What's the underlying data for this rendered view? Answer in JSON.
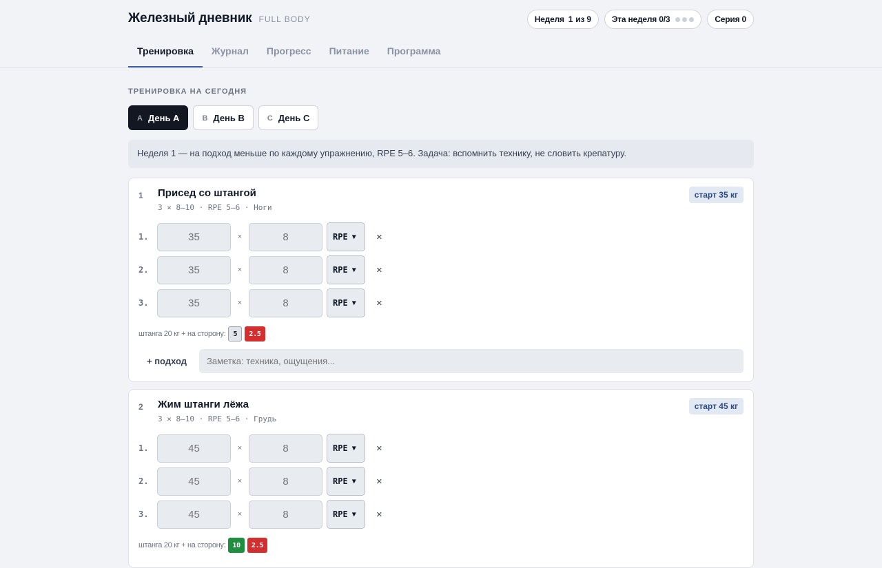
{
  "header": {
    "title": "Железный дневник",
    "subtitle": "FULL BODY",
    "week_label": "Неделя",
    "week_num": "1",
    "week_of": "из 9",
    "this_week": "Эта неделя 0/3",
    "streak": "Серия 0"
  },
  "tabs": [
    "Тренировка",
    "Журнал",
    "Прогресс",
    "Питание",
    "Программа"
  ],
  "section_label": "ТРЕНИРОВКА НА СЕГОДНЯ",
  "days": [
    {
      "letter": "A",
      "label": "День A"
    },
    {
      "letter": "B",
      "label": "День B"
    },
    {
      "letter": "C",
      "label": "День C"
    }
  ],
  "notice": "Неделя 1 — на подход меньше по каждому упражнению, RPE 5–6. Задача: вспомнить технику, не словить крепатуру.",
  "exercises": [
    {
      "num": "1",
      "name": "Присед со штангой",
      "meta": "3 × 8–10 · RPE 5–6 · Ноги",
      "start": "старт 35 кг",
      "sets": [
        {
          "idx": "1.",
          "weight": "35",
          "reps": "8",
          "rpe": "RPE"
        },
        {
          "idx": "2.",
          "weight": "35",
          "reps": "8",
          "rpe": "RPE"
        },
        {
          "idx": "3.",
          "weight": "35",
          "reps": "8",
          "rpe": "RPE"
        }
      ],
      "plates_label": "штанга 20 кг + на сторону:",
      "plates": [
        {
          "value": "5",
          "color": "#e1e4e9"
        },
        {
          "value": "2.5",
          "color": "#d32f2f"
        }
      ],
      "add_set": "+ подход",
      "note_placeholder": "Заметка: техника, ощущения..."
    },
    {
      "num": "2",
      "name": "Жим штанги лёжа",
      "meta": "3 × 8–10 · RPE 5–6 · Грудь",
      "start": "старт 45 кг",
      "sets": [
        {
          "idx": "1.",
          "weight": "45",
          "reps": "8",
          "rpe": "RPE"
        },
        {
          "idx": "2.",
          "weight": "45",
          "reps": "8",
          "rpe": "RPE"
        },
        {
          "idx": "3.",
          "weight": "45",
          "reps": "8",
          "rpe": "RPE"
        }
      ],
      "plates_label": "штанга 20 кг + на сторону:",
      "plates": [
        {
          "value": "10",
          "color": "#1f8f3f"
        },
        {
          "value": "2.5",
          "color": "#d32f2f"
        }
      ]
    }
  ],
  "icons": {
    "times": "×",
    "delete": "×",
    "select_chevron": "chevron-down-icon"
  },
  "colors": {
    "accent": "#3b5ea8",
    "active_day_bg": "#131722",
    "start_badge_bg": "#e3e9f3"
  }
}
